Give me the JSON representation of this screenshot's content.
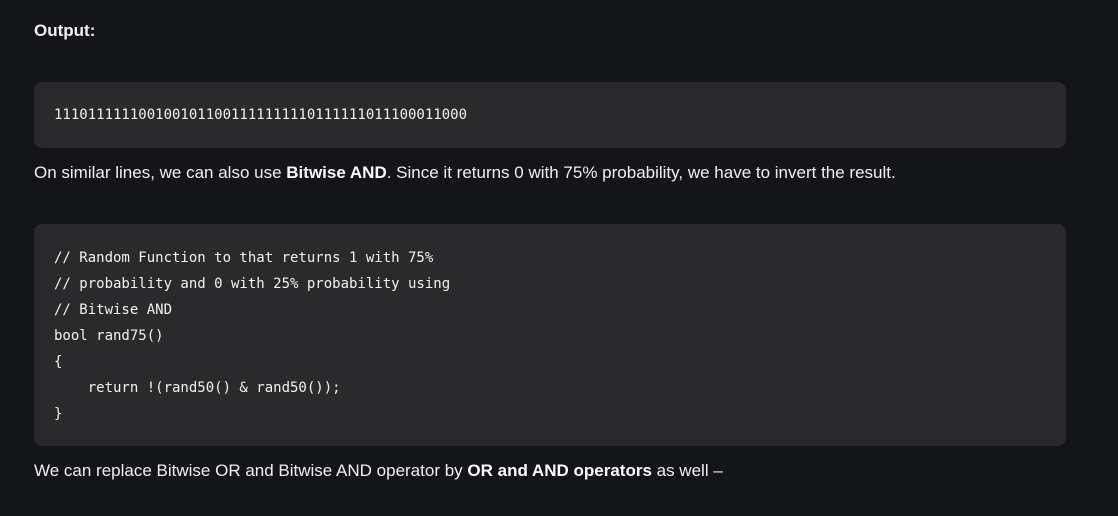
{
  "output_heading": "Output:",
  "output_block": {
    "text": "1110111111001001011001111111110111111011100011000"
  },
  "paragraph1": {
    "before": "On similar lines, we can also use ",
    "bold": "Bitwise AND",
    "after": ". Since it returns 0 with 75% probability, we have to invert the result."
  },
  "code_block": {
    "lines": [
      "// Random Function to that returns 1 with 75%",
      "// probability and 0 with 25% probability using",
      "// Bitwise AND",
      "bool rand75()",
      "{",
      "    return !(rand50() & rand50());",
      "}"
    ]
  },
  "paragraph2": {
    "before": "We can replace Bitwise OR and Bitwise AND operator by ",
    "bold": "OR and AND operators",
    "after": " as well –"
  }
}
